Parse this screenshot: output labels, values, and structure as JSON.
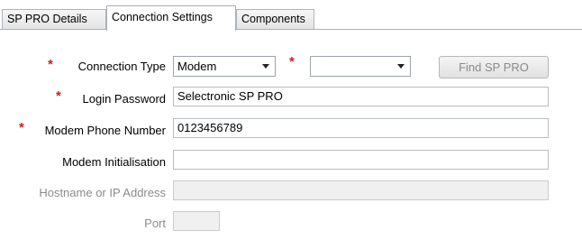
{
  "tabs": [
    {
      "label": "SP PRO Details"
    },
    {
      "label": "Connection Settings"
    },
    {
      "label": "Components"
    }
  ],
  "form": {
    "connection_type": {
      "label": "Connection Type",
      "required_mark": "*",
      "selected": "Modem"
    },
    "secondary_select": {
      "required_mark": "*",
      "selected": ""
    },
    "find_button": {
      "label": "Find SP PRO"
    },
    "login_password": {
      "label": "Login Password",
      "required_mark": "*",
      "value": "Selectronic SP PRO"
    },
    "modem_phone": {
      "label": "Modem Phone Number",
      "required_mark": "*",
      "value": "0123456789"
    },
    "modem_init": {
      "label": "Modem Initialisation",
      "value": ""
    },
    "hostname": {
      "label": "Hostname or IP Address",
      "value": ""
    },
    "port": {
      "label": "Port",
      "value": ""
    }
  }
}
